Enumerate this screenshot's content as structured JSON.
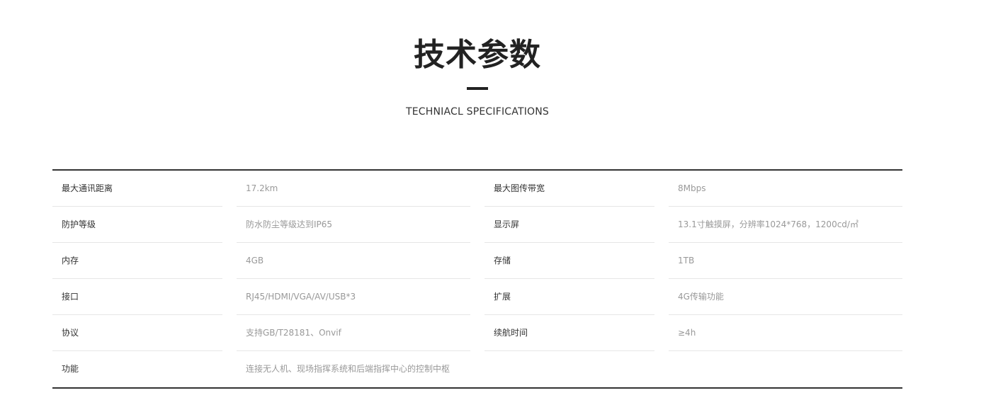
{
  "header": {
    "title": "技术参数",
    "subtitle": "TECHNIACL SPECIFICATIONS"
  },
  "specs": [
    {
      "label1": "最大通讯距离",
      "value1": "17.2km",
      "label2": "最大图传带宽",
      "value2": "8Mbps"
    },
    {
      "label1": "防护等级",
      "value1": "防水防尘等级达到IP65",
      "label2": "显示屏",
      "value2": "13.1寸触摸屏，分辨率1024*768，1200cd/㎡"
    },
    {
      "label1": "内存",
      "value1": "4GB",
      "label2": "存储",
      "value2": "1TB"
    },
    {
      "label1": "接口",
      "value1": "RJ45/HDMI/VGA/AV/USB*3",
      "label2": "扩展",
      "value2": "4G传输功能"
    },
    {
      "label1": "协议",
      "value1": "支持GB/T28181、Onvif",
      "label2": "续航时间",
      "value2": "≥4h"
    },
    {
      "label1": "功能",
      "value1": "连接无人机、现场指挥系统和后端指挥中心的控制中枢",
      "label2": "",
      "value2": ""
    }
  ]
}
